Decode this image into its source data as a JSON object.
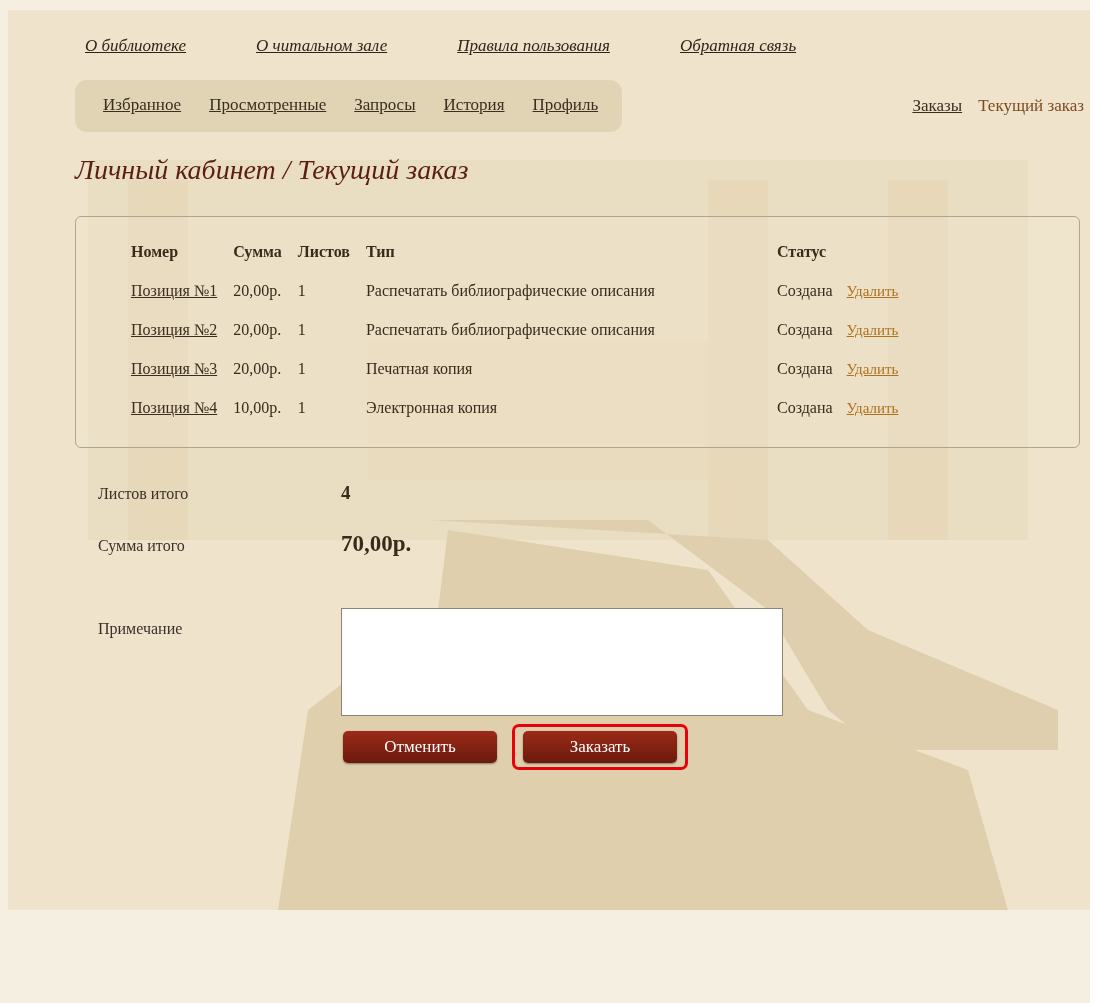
{
  "top_nav": [
    "О библиотеке",
    "О читальном зале",
    "Правила пользования",
    "Обратная связь"
  ],
  "cabinet_nav": [
    "Избранное",
    "Просмотренные",
    "Запросы",
    "История",
    "Профиль"
  ],
  "order_tabs": [
    {
      "label": "Заказы",
      "selected": false
    },
    {
      "label": "Текущий заказ",
      "selected": true
    }
  ],
  "heading": "Личный кабинет / Текущий заказ",
  "table": {
    "columns": [
      "Номер",
      "Сумма",
      "Листов",
      "Тип",
      "Статус"
    ],
    "rows": [
      {
        "number": "Позиция №1",
        "sum": "20,00р.",
        "sheets": "1",
        "type": "Распечатать библиографические описания",
        "status": "Создана",
        "action": "Удалить"
      },
      {
        "number": "Позиция №2",
        "sum": "20,00р.",
        "sheets": "1",
        "type": "Распечатать библиографические описания",
        "status": "Создана",
        "action": "Удалить"
      },
      {
        "number": "Позиция №3",
        "sum": "20,00р.",
        "sheets": "1",
        "type": "Печатная копия",
        "status": "Создана",
        "action": "Удалить"
      },
      {
        "number": "Позиция №4",
        "sum": "10,00р.",
        "sheets": "1",
        "type": "Электронная копия",
        "status": "Создана",
        "action": "Удалить"
      }
    ]
  },
  "totals": [
    {
      "label": "Листов итого",
      "value": "4",
      "kind": "count"
    },
    {
      "label": "Сумма итого",
      "value": "70,00р.",
      "kind": "sum"
    }
  ],
  "note": {
    "label": "Примечание"
  },
  "buttons": [
    {
      "label": "Отменить",
      "highlighted": false
    },
    {
      "label": "Заказать",
      "highlighted": true
    }
  ]
}
